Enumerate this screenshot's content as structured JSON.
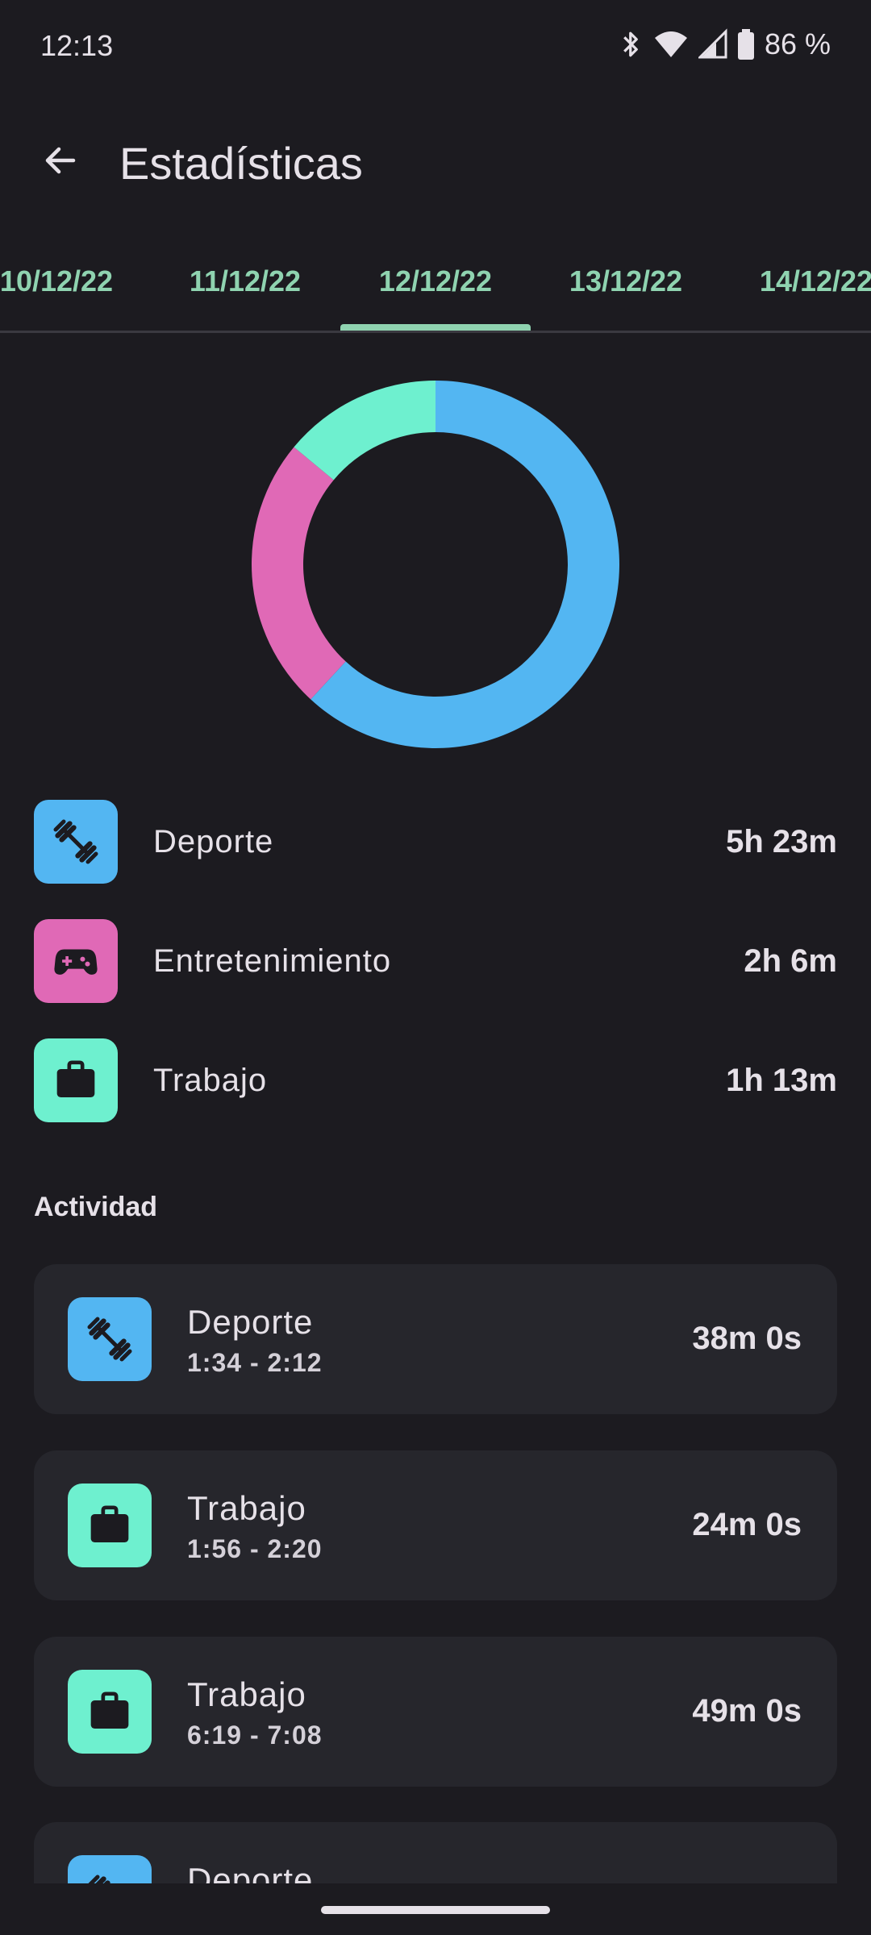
{
  "status_bar": {
    "time": "12:13",
    "battery": "86 %"
  },
  "header": {
    "title": "Estadísticas"
  },
  "tabs": [
    {
      "label": "10/12/22"
    },
    {
      "label": "11/12/22"
    },
    {
      "label": "12/12/22",
      "selected": true
    },
    {
      "label": "13/12/22"
    },
    {
      "label": "14/12/22"
    }
  ],
  "donut": {
    "segments": [
      {
        "category": "Deporte",
        "minutes": 323,
        "color": "#53b6f2"
      },
      {
        "category": "Entretenimiento",
        "minutes": 126,
        "color": "#e069b6"
      },
      {
        "category": "Trabajo",
        "minutes": 73,
        "color": "#6ef0cf"
      }
    ]
  },
  "summary": [
    {
      "name": "Deporte",
      "time": "5h 23m",
      "color": "#53b6f2",
      "icon": "dumbbell-icon"
    },
    {
      "name": "Entretenimiento",
      "time": "2h 6m",
      "color": "#e069b6",
      "icon": "gamepad-icon"
    },
    {
      "name": "Trabajo",
      "time": "1h 13m",
      "color": "#6ef0cf",
      "icon": "briefcase-icon"
    }
  ],
  "activity": {
    "title": "Actividad",
    "items": [
      {
        "name": "Deporte",
        "range": "1:34 - 2:12",
        "duration": "38m 0s",
        "color": "#53b6f2",
        "icon": "dumbbell-icon"
      },
      {
        "name": "Trabajo",
        "range": "1:56 - 2:20",
        "duration": "24m 0s",
        "color": "#6ef0cf",
        "icon": "briefcase-icon"
      },
      {
        "name": "Trabajo",
        "range": "6:19 - 7:08",
        "duration": "49m 0s",
        "color": "#6ef0cf",
        "icon": "briefcase-icon"
      },
      {
        "name": "Deporte",
        "range": "",
        "duration": "",
        "color": "#53b6f2",
        "icon": "dumbbell-icon"
      }
    ]
  }
}
